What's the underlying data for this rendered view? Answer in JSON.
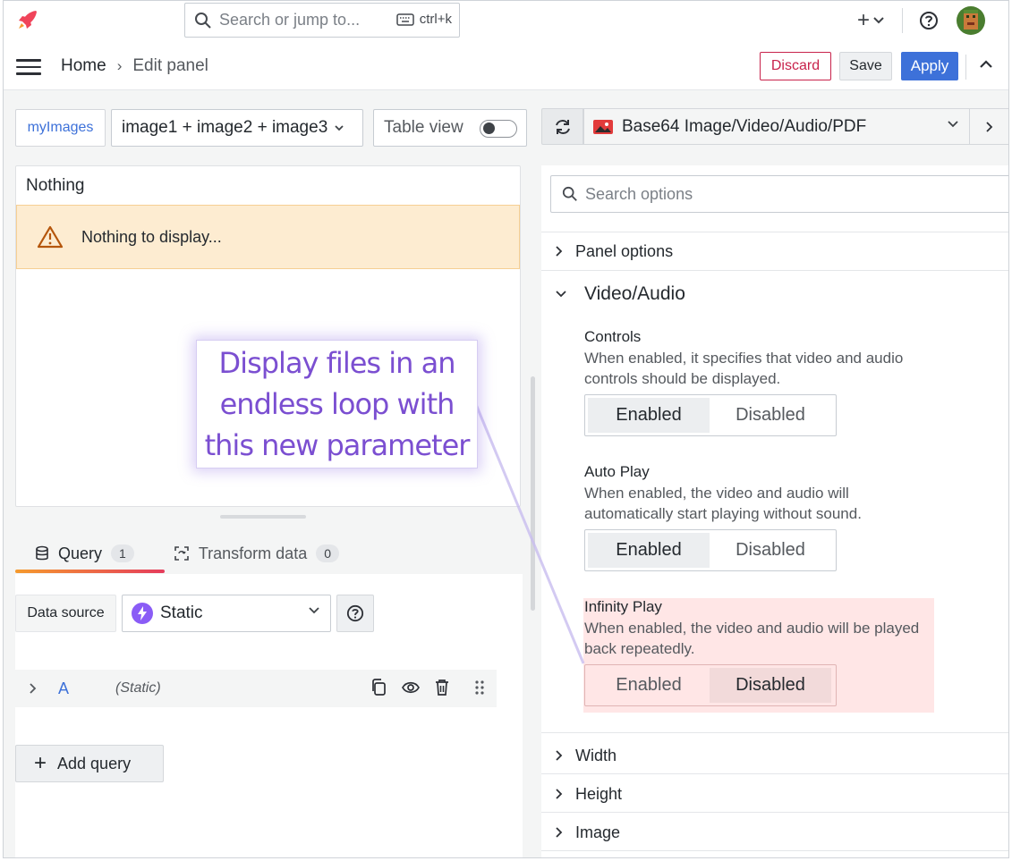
{
  "topbar": {
    "search_placeholder": "Search or jump to...",
    "shortcut": "ctrl+k"
  },
  "subbar": {
    "breadcrumb_home": "Home",
    "breadcrumb_separator": "›",
    "breadcrumb_current": "Edit panel",
    "discard_label": "Discard",
    "save_label": "Save",
    "apply_label": "Apply"
  },
  "editor": {
    "datasource_tag": "myImages",
    "query_selector": "image1 + image2 + image3",
    "table_view_label": "Table view"
  },
  "preview": {
    "panel_title": "Nothing",
    "warning_text": "Nothing to display..."
  },
  "query_tabs": [
    {
      "label": "Query",
      "count": "1"
    },
    {
      "label": "Transform data",
      "count": "0"
    }
  ],
  "query_editor": {
    "data_source_label": "Data source",
    "data_source_value": "Static",
    "query_ref_id": "A",
    "query_ds_name": "(Static)",
    "add_query_label": "Add query"
  },
  "visualization": {
    "name": "Base64 Image/Video/Audio/PDF"
  },
  "options": {
    "search_placeholder": "Search options",
    "sections": {
      "panel_options": "Panel options",
      "video_audio": "Video/Audio",
      "width": "Width",
      "height": "Height",
      "image": "Image"
    },
    "controls": {
      "title": "Controls",
      "desc": "When enabled, it specifies that video and audio controls should be displayed.",
      "enabled": "Enabled",
      "disabled": "Disabled",
      "selected": "Enabled"
    },
    "auto_play": {
      "title": "Auto Play",
      "desc": "When enabled, the video and audio will automatically start playing without sound.",
      "enabled": "Enabled",
      "disabled": "Disabled",
      "selected": "Enabled"
    },
    "infinity_play": {
      "title": "Infinity Play",
      "desc": "When enabled, the video and audio will be played back repeatedly.",
      "enabled": "Enabled",
      "disabled": "Disabled",
      "selected": "Disabled"
    }
  },
  "callout": {
    "line1": "Display files in an",
    "line2": "endless loop with",
    "line3": "this new parameter"
  },
  "colors": {
    "primary": "#3d71d9",
    "discard": "#c8224b",
    "warning_bg": "#fdecd1",
    "highlight_bg": "#ffe6e6",
    "callout_text": "#7b4fd1"
  },
  "icons": [
    "rocket-logo-icon",
    "search-icon",
    "keyboard-icon",
    "plus-icon",
    "chevron-down-icon",
    "help-icon",
    "avatar",
    "menu-icon",
    "chevron-up-icon",
    "warning-icon",
    "database-icon",
    "transform-icon",
    "bolt-icon",
    "chevron-right-icon",
    "copy-icon",
    "eye-icon",
    "trash-icon",
    "drag-handle-icon",
    "refresh-icon",
    "image-icon"
  ]
}
